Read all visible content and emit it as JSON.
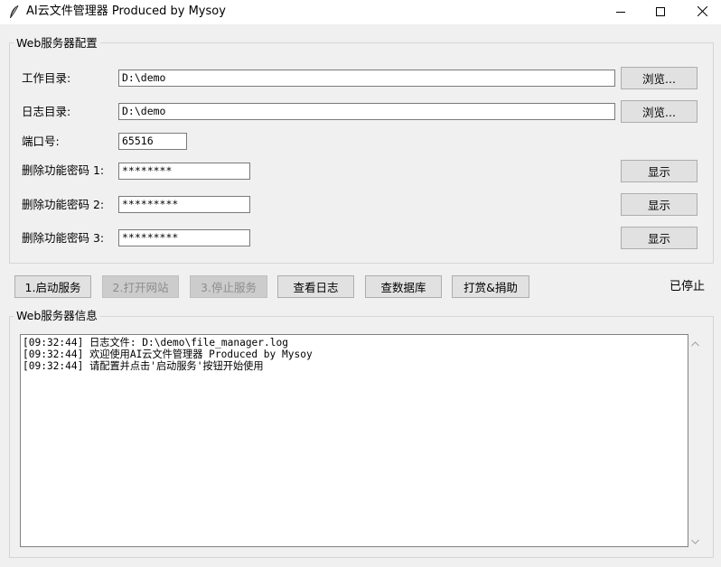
{
  "window": {
    "title": "AI云文件管理器 Produced by Mysoy",
    "icon": "feather-icon",
    "controls": [
      "minimize-icon",
      "maximize-icon",
      "close-icon"
    ]
  },
  "config_group": {
    "title": "Web服务器配置",
    "work_dir": {
      "label": "工作目录:",
      "value": "D:\\demo",
      "browse_label": "浏览..."
    },
    "log_dir": {
      "label": "日志目录:",
      "value": "D:\\demo",
      "browse_label": "浏览..."
    },
    "port": {
      "label": "端口号:",
      "value": "65516"
    },
    "passwords": [
      {
        "label": "删除功能密码 1:",
        "value": "********",
        "show_label": "显示"
      },
      {
        "label": "删除功能密码 2:",
        "value": "*********",
        "show_label": "显示"
      },
      {
        "label": "删除功能密码 3:",
        "value": "*********",
        "show_label": "显示"
      }
    ]
  },
  "actions": {
    "start": "1.启动服务",
    "open_site": "2.打开网站",
    "stop": "3.停止服务",
    "view_log": "查看日志",
    "view_db": "查数据库",
    "donate": "打赏&捐助",
    "disabled": [
      "open_site",
      "stop"
    ]
  },
  "status": "已停止",
  "info_group": {
    "title": "Web服务器信息",
    "log_lines": [
      "[09:32:44] 日志文件: D:\\demo\\file_manager.log",
      "[09:32:44] 欢迎使用AI云文件管理器 Produced by Mysoy",
      "[09:32:44] 请配置并点击'启动服务'按钮开始使用"
    ]
  }
}
